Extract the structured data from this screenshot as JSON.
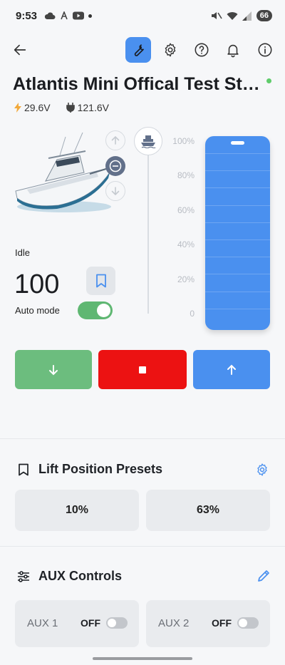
{
  "status_bar": {
    "time": "9:53",
    "battery": "66"
  },
  "device": {
    "title": "Atlantis Mini Offical Test Sta...",
    "battery_voltage": "29.6V",
    "plug_voltage": "121.6V"
  },
  "lift": {
    "state": "Idle",
    "value": "100",
    "auto_mode_label": "Auto mode",
    "auto_mode": true,
    "position_fraction": 1.0,
    "scale": [
      "100%",
      "80%",
      "60%",
      "40%",
      "20%",
      "0"
    ]
  },
  "presets": {
    "title": "Lift Position Presets",
    "items": [
      "10%",
      "63%"
    ]
  },
  "aux": {
    "title": "AUX Controls",
    "items": [
      {
        "name": "AUX 1",
        "state": "OFF"
      },
      {
        "name": "AUX 2",
        "state": "OFF"
      }
    ]
  },
  "colors": {
    "accent": "#4a90ef",
    "down": "#6cbd7e",
    "stop": "#ec1212",
    "online": "#5fcc6b"
  }
}
